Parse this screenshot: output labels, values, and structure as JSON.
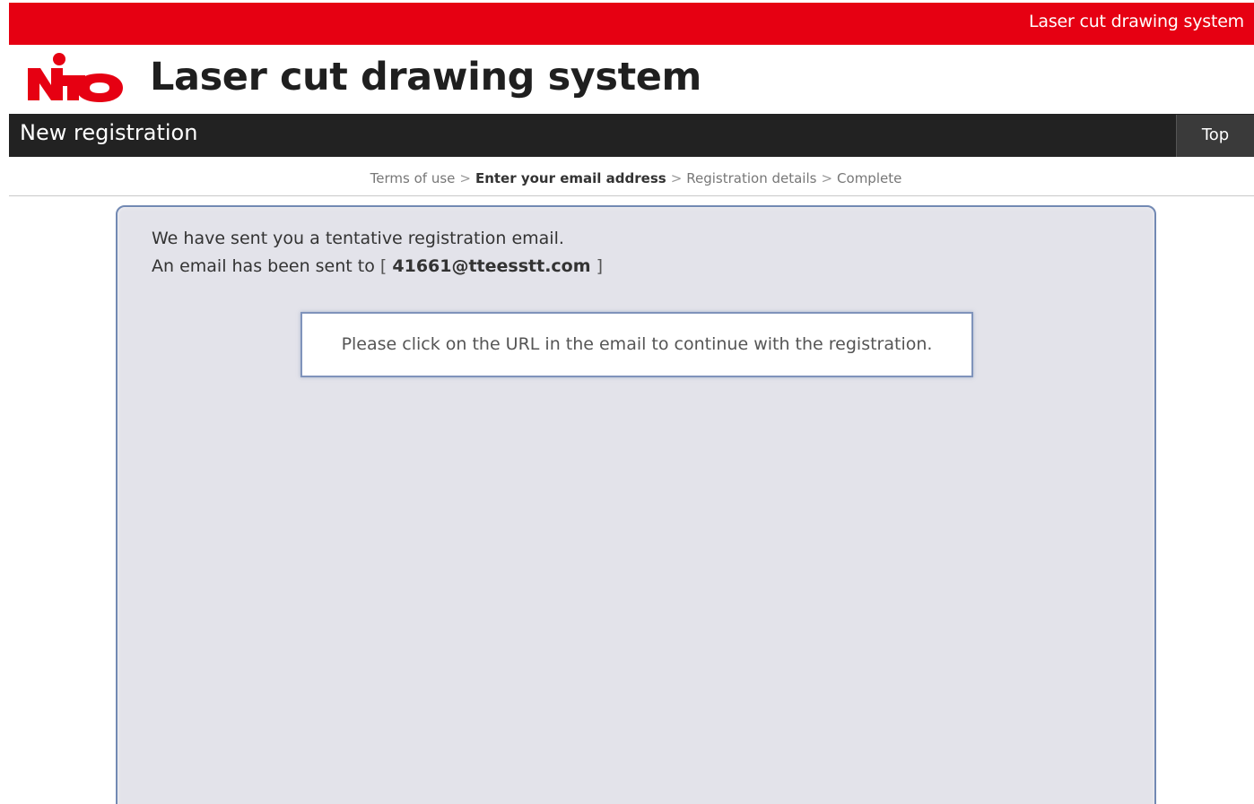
{
  "topbar": {
    "system_name": "Laser cut drawing system"
  },
  "header": {
    "logo_text": "NITO",
    "title": "Laser cut drawing system"
  },
  "navbar": {
    "page_title": "New registration",
    "top_button": "Top"
  },
  "steps": {
    "items": [
      "Terms of use",
      "Enter your email address",
      "Registration details",
      "Complete"
    ],
    "separator": ">",
    "current_index": 1
  },
  "message": {
    "line_one": "We have sent you a tentative registration email.",
    "line_two_prefix": "An email has been sent to",
    "open_bracket": "[",
    "email": "41661@tteesstt.com",
    "close_bracket": "]"
  },
  "notice": {
    "text": "Please click on the URL in the email to continue with the registration."
  },
  "colors": {
    "brand_red": "#e60012",
    "nav_dark": "#222222",
    "panel_background": "#e3e3ea",
    "panel_border": "#7289b3"
  }
}
